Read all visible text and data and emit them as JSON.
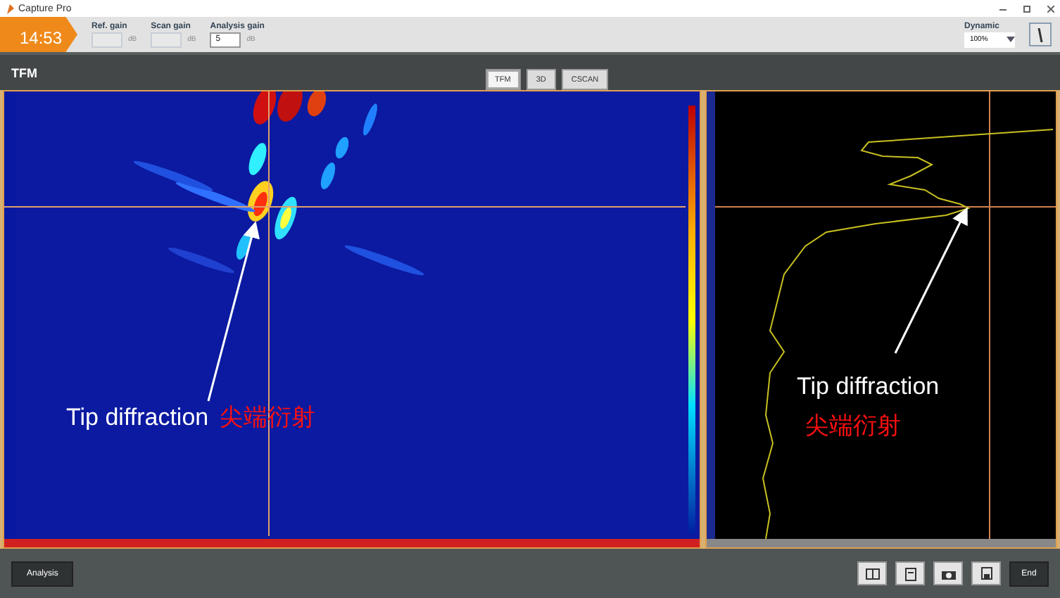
{
  "window": {
    "title": "Capture Pro"
  },
  "toolbar": {
    "time": "14:53",
    "gains": [
      {
        "label": "Ref. gain",
        "unit": "dB",
        "disabled": true
      },
      {
        "label": "Scan gain",
        "unit": "dB",
        "disabled": true
      },
      {
        "label": "Analysis gain",
        "value": "5",
        "unit": "dB",
        "disabled": false
      }
    ],
    "dynamic": {
      "label": "Dynamic",
      "value": "100%"
    }
  },
  "view": {
    "title": "TFM",
    "tabs": [
      {
        "label": "TFM",
        "selected": true
      },
      {
        "label": "3D",
        "selected": false
      },
      {
        "label": "CSCAN",
        "selected": false
      }
    ]
  },
  "panels": [
    {
      "kind": "tfm",
      "annotation": {
        "label": "Tip diffraction",
        "label_cn": "尖端衍射"
      }
    },
    {
      "kind": "profile",
      "annotation": {
        "label": "Tip diffraction",
        "label_cn": "尖端衍射"
      }
    }
  ],
  "bottom_bar": {
    "mode_button": "Analysis",
    "end_button": "End"
  }
}
